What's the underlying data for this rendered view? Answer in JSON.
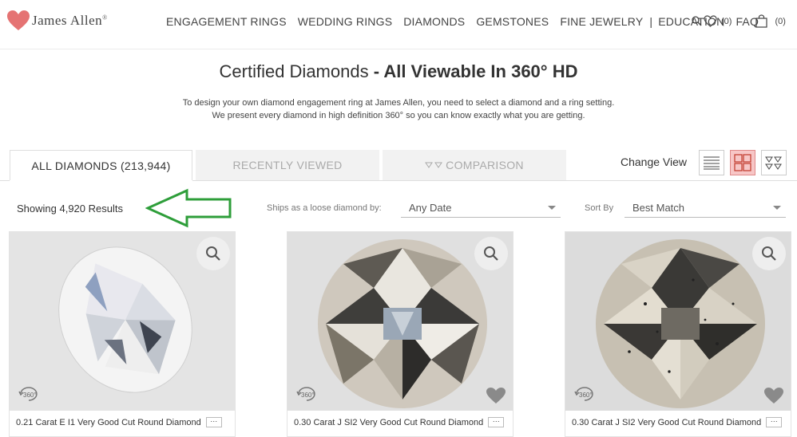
{
  "header": {
    "brand": "James Allen",
    "nav": [
      "ENGAGEMENT RINGS",
      "WEDDING RINGS",
      "DIAMONDS",
      "GEMSTONES",
      "FINE JEWELRY",
      "EDUCATION",
      "FAQ"
    ],
    "wishlist_count": "(0)",
    "cart_count": "(0)"
  },
  "title": {
    "light": "Certified Diamonds",
    "dash": " - ",
    "bold": "All Viewable In 360° HD"
  },
  "intro": {
    "line1": "To design your own diamond engagement ring at James Allen, you need to select a diamond and a ring setting.",
    "line2": "We present every diamond in high definition 360° so you can know exactly what you are getting."
  },
  "tabs": {
    "all": "ALL DIAMONDS",
    "all_count": "(213,944)",
    "recent": "RECENTLY VIEWED",
    "compare": "COMPARISON"
  },
  "view": {
    "label": "Change View",
    "selected": "grid"
  },
  "filters": {
    "results": "Showing 4,920 Results",
    "ships_label": "Ships as a loose diamond by:",
    "ships_value": "Any Date",
    "sort_label": "Sort By",
    "sort_value": "Best Match"
  },
  "cards": [
    {
      "caption": "0.21 Carat E I1 Very Good Cut Round Diamond",
      "badge": "360°"
    },
    {
      "caption": "0.30 Carat J SI2 Very Good Cut Round Diamond",
      "badge": "360°"
    },
    {
      "caption": "0.30 Carat J SI2 Very Good Cut Round Diamond",
      "badge": "360°"
    }
  ],
  "colors": {
    "brand": "#e57373",
    "annotation": "#2e9e3a",
    "grid_selected": "#f7c6c6"
  }
}
